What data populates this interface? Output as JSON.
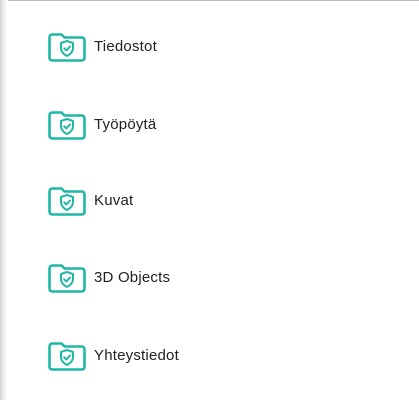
{
  "colors": {
    "accent": "#1fb7a6",
    "text": "#212121"
  },
  "folders": [
    {
      "label": "Tiedostot",
      "icon": "shield-folder-icon"
    },
    {
      "label": "Työpöytä",
      "icon": "shield-folder-icon"
    },
    {
      "label": "Kuvat",
      "icon": "shield-folder-icon"
    },
    {
      "label": "3D Objects",
      "icon": "shield-folder-icon"
    },
    {
      "label": "Yhteystiedot",
      "icon": "shield-folder-icon"
    }
  ]
}
